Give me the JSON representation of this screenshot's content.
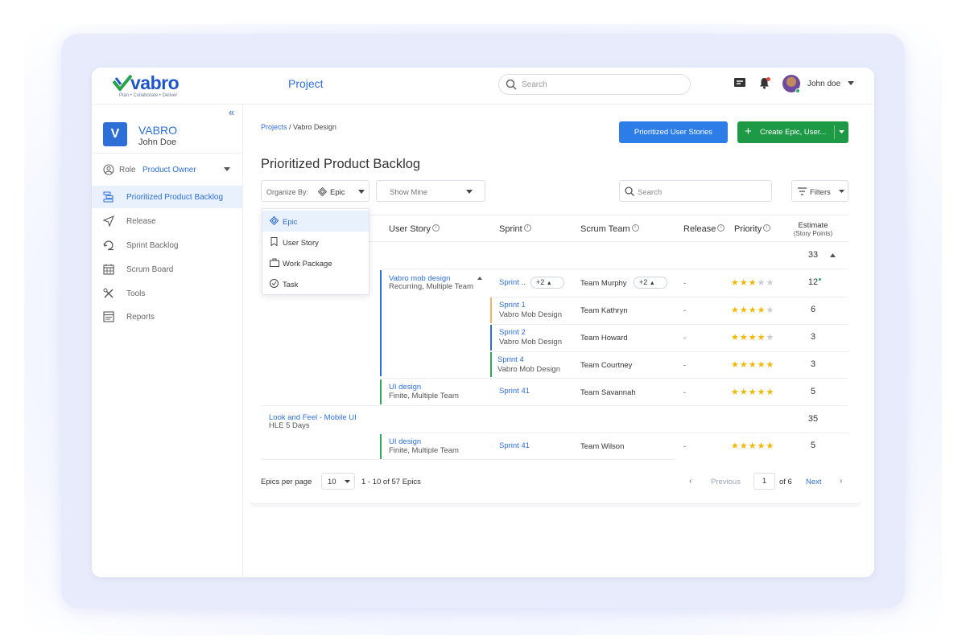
{
  "app": {
    "logo_text": "vabro",
    "logo_tagline": "Plan • Collaborate • Deliver",
    "project_title": "Project",
    "search_placeholder": "Search",
    "user_name": "John doe"
  },
  "sidebar": {
    "workspace_initial": "V",
    "workspace_name": "VABRO",
    "workspace_user": "John Doe",
    "role_label": "Role",
    "role_value": "Product Owner",
    "items": [
      {
        "label": "Prioritized Product Backlog",
        "icon": "backlog-icon",
        "active": true
      },
      {
        "label": "Release",
        "icon": "send-icon",
        "active": false
      },
      {
        "label": "Sprint Backlog",
        "icon": "cycle-icon",
        "active": false
      },
      {
        "label": "Scrum Board",
        "icon": "calendar-icon",
        "active": false
      },
      {
        "label": "Tools",
        "icon": "tools-icon",
        "active": false
      },
      {
        "label": "Reports",
        "icon": "report-icon",
        "active": false
      }
    ]
  },
  "main": {
    "breadcrumb_link": "Projects",
    "breadcrumb_sep": " / ",
    "breadcrumb_current": "Vabro Design",
    "btn_prioritized": "Prioritized User Stories",
    "btn_create": "Create  Epic, User...",
    "page_title": "Prioritized Product Backlog",
    "organize_label": "Organize By:",
    "organize_value": "Epic",
    "show_mine": "Show Mine",
    "table_search_placeholder": "Search",
    "filters_label": "Filters"
  },
  "dropdown": {
    "items": [
      {
        "label": "Epic",
        "icon": "epic-icon",
        "selected": true
      },
      {
        "label": "User Story",
        "icon": "bookmark-icon",
        "selected": false
      },
      {
        "label": "Work Package",
        "icon": "briefcase-icon",
        "selected": false
      },
      {
        "label": "Task",
        "icon": "check-circle-icon",
        "selected": false
      }
    ]
  },
  "table": {
    "headers": {
      "user_story": "User Story",
      "sprint": "Sprint",
      "scrum_team": "Scrum Team",
      "release": "Release",
      "priority": "Priority",
      "estimate": "Estimate",
      "estimate_sub": "(Story Points)"
    },
    "epic1_total": "33",
    "story1_title": "Vabro mob design",
    "story1_sub": "Recurring, Multiple Team",
    "row1": {
      "sprint": "Sprint ..",
      "sprint_more": "+2",
      "team": "Team  Murphy",
      "team_more": "+2",
      "release": "-",
      "stars": 3,
      "estimate": "12"
    },
    "row2": {
      "sprint": "Sprint 1",
      "sprint_sub": "Vabro Mob Design",
      "team": "Team Kathryn",
      "release": "-",
      "stars": 4,
      "estimate": "6"
    },
    "row3": {
      "sprint": "Sprint 2",
      "sprint_sub": "Vabro Mob Design",
      "team": "Team Howard",
      "release": "-",
      "stars": 4,
      "estimate": "3"
    },
    "row4": {
      "sprint": "Sprint 4",
      "sprint_sub": "Vabro Mob Design",
      "team": "Team Courtney",
      "release": "-",
      "stars": 5,
      "estimate": "3"
    },
    "story2_title": "UI design",
    "story2_sub": "Finite, Multiple Team",
    "row5": {
      "sprint": "Sprint 41",
      "team": "Team Savannah",
      "release": "-",
      "stars": 5,
      "estimate": "5"
    },
    "epic2_title": "Look and Feel - Mobile UI",
    "epic2_sub": "HLE 5 Days",
    "epic2_total": "35",
    "story3_title": "UI design",
    "story3_sub": "Finite, Multiple Team",
    "row6": {
      "sprint": "Sprint 41",
      "team": "Team Wilson",
      "release": "-",
      "stars": 5,
      "estimate": "5"
    }
  },
  "pagination": {
    "per_page_label": "Epics per page",
    "per_page_value": "10",
    "range": "1 - 10 of 57 Epics",
    "prev_label": "Previous",
    "page_value": "1",
    "of_pages": "of 6",
    "next_label": "Next"
  },
  "colors": {
    "brand_blue": "#2d6fd6",
    "create_green": "#1e9a47",
    "star": "#f2b705",
    "bar_blue": "#2d6fd6",
    "bar_orange": "#f0b360",
    "bar_green": "#2eaa57"
  }
}
